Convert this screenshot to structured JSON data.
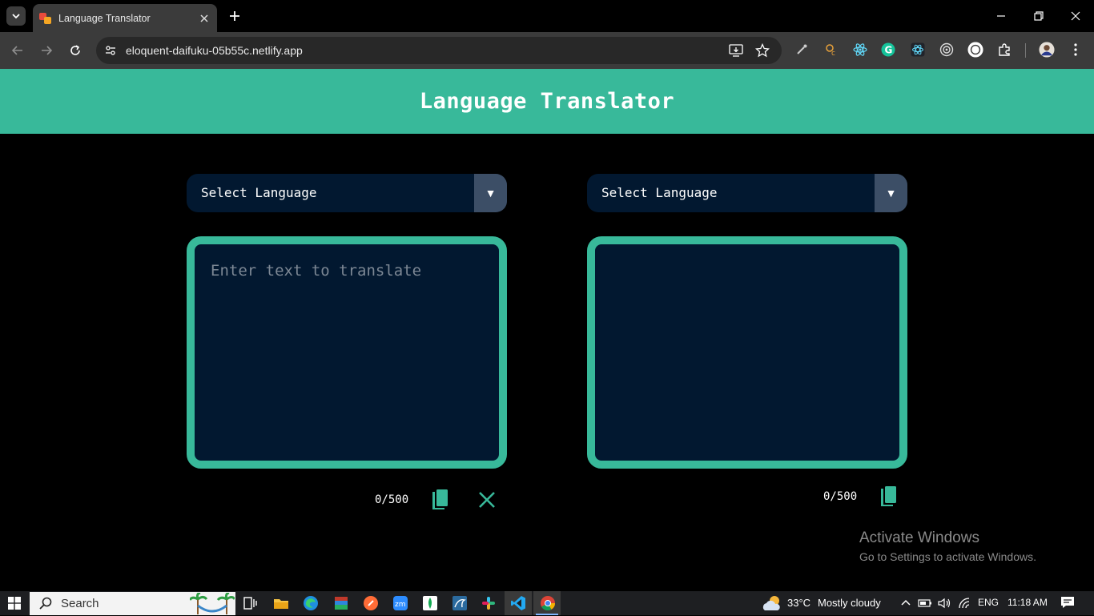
{
  "browser": {
    "tab_title": "Language Translator",
    "url": "eloquent-daifuku-05b55c.netlify.app"
  },
  "app": {
    "title": "Language Translator",
    "source_select_label": "Select Language",
    "target_select_label": "Select Language",
    "source_placeholder": "Enter text to translate",
    "source_value": "",
    "target_value": "",
    "source_count": "0/500",
    "target_count": "0/500",
    "accent_color": "#38b99a",
    "panel_color": "#021830"
  },
  "watermark": {
    "line1": "Activate Windows",
    "line2": "Go to Settings to activate Windows."
  },
  "taskbar": {
    "search_label": "Search",
    "weather_temp": "33°C",
    "weather_desc": "Mostly cloudy",
    "language": "ENG",
    "time": "11:18 AM"
  }
}
